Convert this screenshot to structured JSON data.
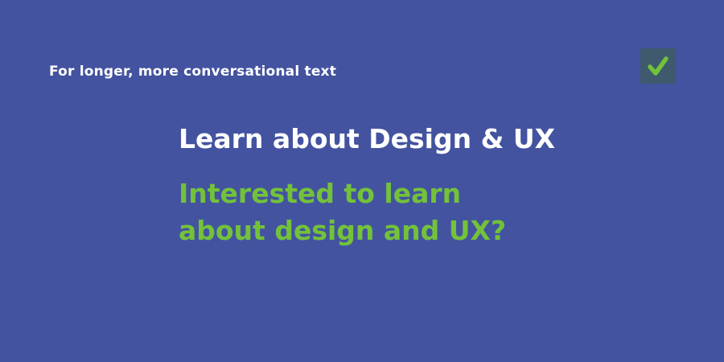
{
  "caption": "For longer, more conversational text",
  "heading": "Learn about Design & UX",
  "subheading": {
    "line1": "Interested to learn",
    "line2": "about design and UX?"
  },
  "badge": {
    "icon": "checkmark-icon",
    "background_color": "#3f5a6d",
    "icon_color": "#73c23a"
  },
  "colors": {
    "background": "#4353a0",
    "heading": "#ffffff",
    "subheading": "#73c23a"
  }
}
